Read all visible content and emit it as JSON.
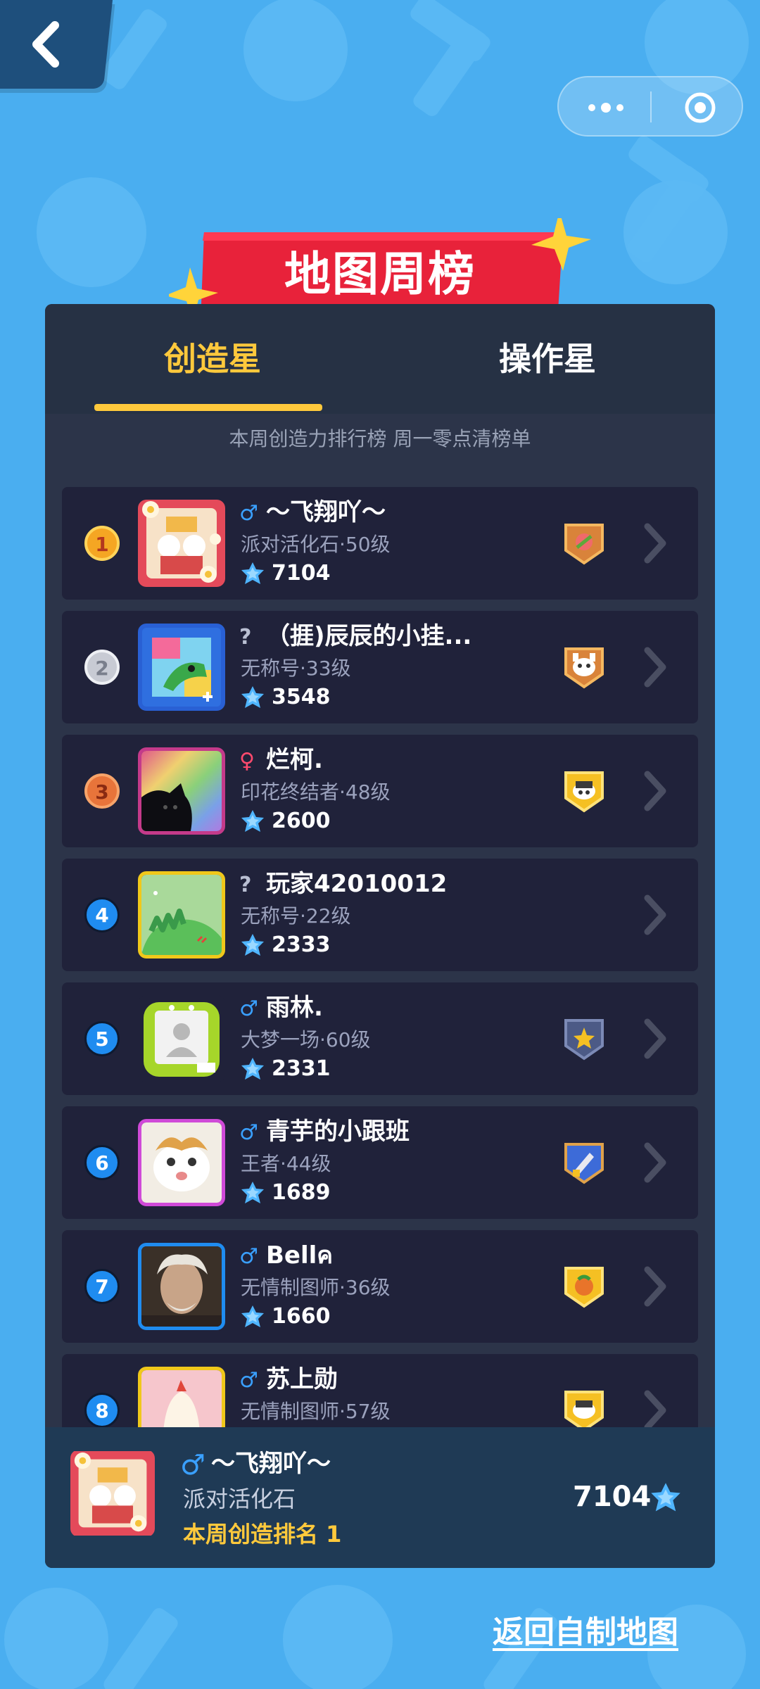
{
  "colors": {
    "background": "#4aaef0",
    "accent": "#ffc93c",
    "banner_red": "#e8223a",
    "panel": "#2c3449",
    "row": "#20223a"
  },
  "header": {
    "back_icon": "chevron-left-icon",
    "capsule_more_icon": "more-dots-icon",
    "capsule_close_icon": "target-icon"
  },
  "banner": {
    "title": "地图周榜"
  },
  "tabs": [
    {
      "label": "创造星",
      "active": true
    },
    {
      "label": "操作星",
      "active": false
    }
  ],
  "subtitle": "本周创造力排行榜 周一零点清榜单",
  "rows": [
    {
      "rank": "1",
      "gender": "♂",
      "gender_color": "#3aa0ff",
      "name": "～飞翔吖～",
      "title": "派对活化石·50级",
      "score": "7104"
    },
    {
      "rank": "2",
      "gender": "?",
      "gender_color": "#b9bfd2",
      "name": "（捱)辰辰的小挂...",
      "title": "无称号·33级",
      "score": "3548"
    },
    {
      "rank": "3",
      "gender": "♀",
      "gender_color": "#ff4a6e",
      "name": "烂柯.",
      "title": "印花终结者·48级",
      "score": "2600"
    },
    {
      "rank": "4",
      "gender": "?",
      "gender_color": "#b9bfd2",
      "name": "玩家42010012",
      "title": "无称号·22级",
      "score": "2333"
    },
    {
      "rank": "5",
      "gender": "♂",
      "gender_color": "#3aa0ff",
      "name": "雨林.",
      "title": "大梦一场·60级",
      "score": "2331"
    },
    {
      "rank": "6",
      "gender": "♂",
      "gender_color": "#3aa0ff",
      "name": "青芋的小跟班",
      "title": "王者·44级",
      "score": "1689"
    },
    {
      "rank": "7",
      "gender": "♂",
      "gender_color": "#3aa0ff",
      "name": "Bellค",
      "title": "无情制图师·36级",
      "score": "1660"
    },
    {
      "rank": "8",
      "gender": "♂",
      "gender_color": "#3aa0ff",
      "name": "苏上勋",
      "title": "无情制图师·57级",
      "score": ""
    }
  ],
  "footer": {
    "gender": "♂",
    "name": "～飞翔吖～",
    "title": "派对活化石",
    "rank_text": "本周创造排名 1",
    "score": "7104"
  },
  "return_link": "返回自制地图"
}
